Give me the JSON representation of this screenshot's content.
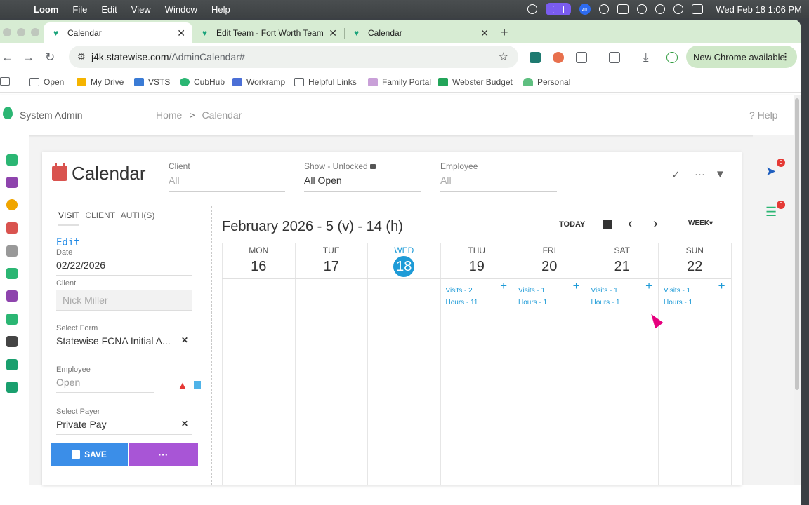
{
  "menubar": {
    "app": "Loom",
    "items": [
      "File",
      "Edit",
      "View",
      "Window",
      "Help"
    ],
    "datetime": "Wed Feb 18  1:06 PM"
  },
  "browser": {
    "tabs": [
      {
        "title": "Calendar",
        "active": true
      },
      {
        "title": "Edit Team - Fort Worth Team",
        "active": false
      },
      {
        "title": "Calendar",
        "active": false
      }
    ],
    "url_host": "j4k.statewise.com",
    "url_path": "/AdminCalendar#",
    "new_chrome": "New Chrome available",
    "bookmarks": [
      "Open",
      "My Drive",
      "VSTS",
      "CubHub",
      "Workramp",
      "Helpful Links",
      "Family Portal",
      "Webster Budget",
      "Personal"
    ]
  },
  "app": {
    "org": "System Admin",
    "breadcrumb": {
      "home": "Home",
      "sep": ">",
      "current": "Calendar"
    },
    "help": "? Help",
    "title": "Calendar",
    "filters": {
      "client": {
        "label": "Client",
        "value": "All"
      },
      "show": {
        "label": "Show - Unlocked",
        "value": "All Open"
      },
      "employee": {
        "label": "Employee",
        "value": "All"
      }
    },
    "right_rail": {
      "send_badge": "0",
      "tasks_badge": "0"
    }
  },
  "side": {
    "tabs": [
      "VISIT",
      "CLIENT",
      "AUTH(S)"
    ],
    "edit": "Edit",
    "date": {
      "label": "Date",
      "value": "02/22/2026"
    },
    "client": {
      "label": "Client",
      "value": "Nick Miller"
    },
    "form": {
      "label": "Select Form",
      "value": "Statewise FCNA Initial A..."
    },
    "employee": {
      "label": "Employee",
      "value": "Open"
    },
    "payer": {
      "label": "Select Payer",
      "value": "Private Pay"
    },
    "save": "SAVE",
    "more": "···"
  },
  "calendar": {
    "range": "February 2026 - 5 (v) - 14 (h)",
    "today": "TODAY",
    "view": "WEEK",
    "days": [
      {
        "dow": "MON",
        "num": "16",
        "visits": "",
        "hours": ""
      },
      {
        "dow": "TUE",
        "num": "17",
        "visits": "",
        "hours": ""
      },
      {
        "dow": "WED",
        "num": "18",
        "visits": "",
        "hours": "",
        "today": true
      },
      {
        "dow": "THU",
        "num": "19",
        "visits": "Visits - 2",
        "hours": "Hours - 11"
      },
      {
        "dow": "FRI",
        "num": "20",
        "visits": "Visits - 1",
        "hours": "Hours - 1"
      },
      {
        "dow": "SAT",
        "num": "21",
        "visits": "Visits - 1",
        "hours": "Hours - 1"
      },
      {
        "dow": "SUN",
        "num": "22",
        "visits": "Visits - 1",
        "hours": "Hours - 1"
      }
    ]
  },
  "colors": {
    "accent": "#1e9bd7",
    "save": "#3b8ee8",
    "more": "#a855d6",
    "tabstrip": "#d7ecd3",
    "brand_green": "#2bb673"
  }
}
